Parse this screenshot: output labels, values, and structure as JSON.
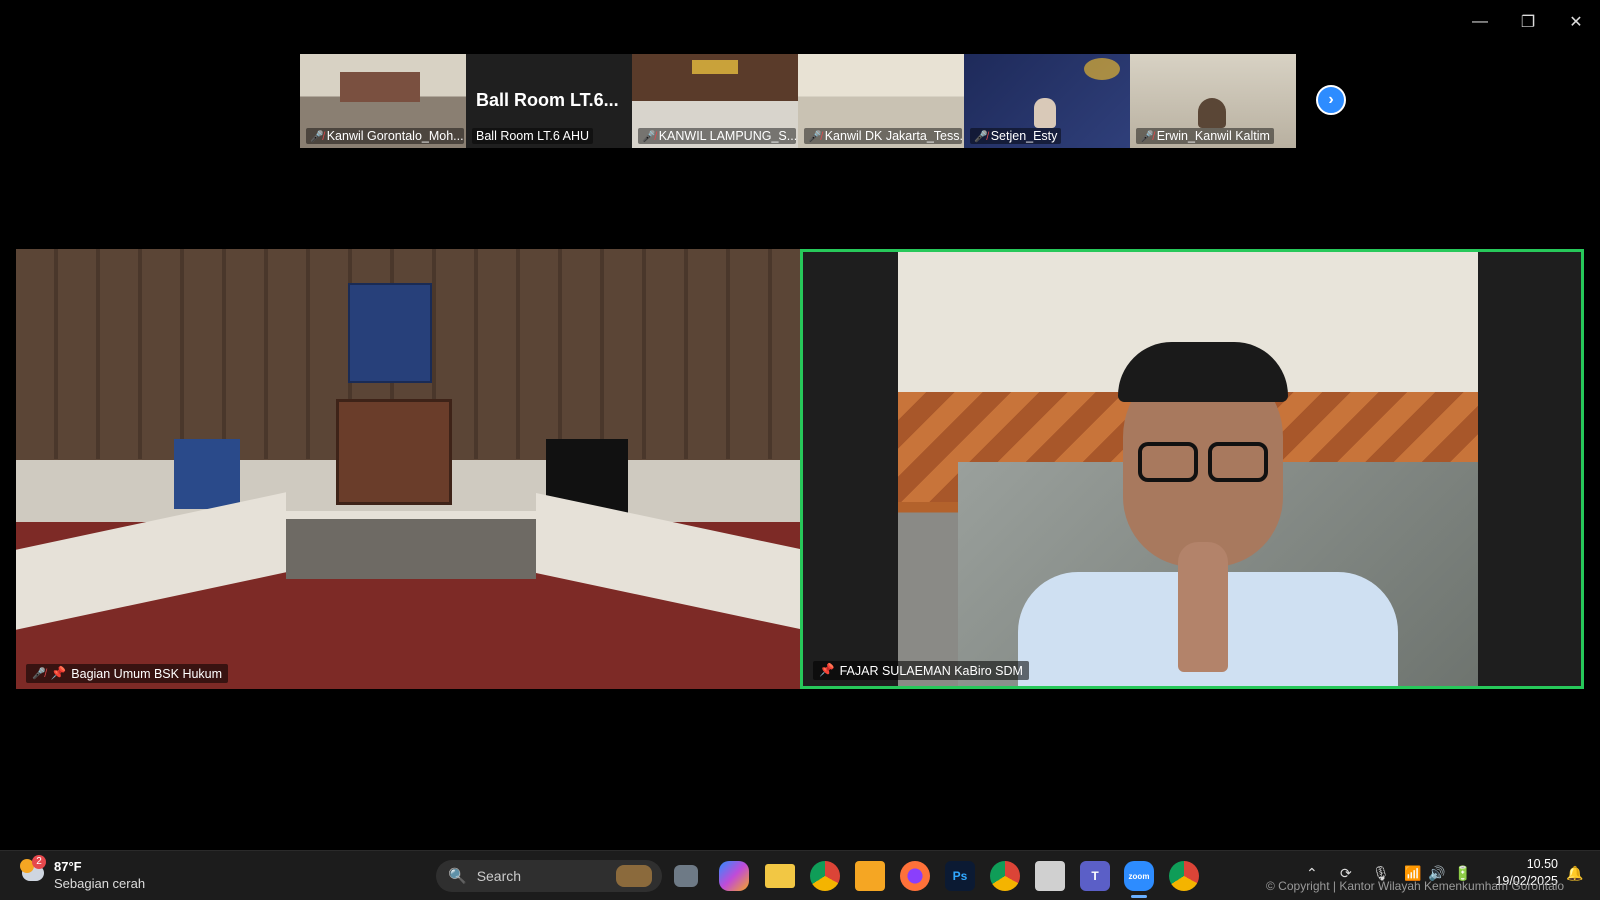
{
  "window_controls": {
    "minimize": "—",
    "restore": "❐",
    "close": "✕"
  },
  "thumbnails": [
    {
      "name": "Kanwil Gorontalo_Moh...",
      "muted": true,
      "bg": "#8a7f72"
    },
    {
      "name": "Ball Room LT.6 AHU",
      "title": "Ball Room LT.6...",
      "muted": false,
      "bg": "#1f1f1f"
    },
    {
      "name": "KANWIL LAMPUNG_S...",
      "muted": true,
      "bg": "#5a3b2a"
    },
    {
      "name": "Kanwil DK Jakarta_Tess...",
      "muted": true,
      "bg": "#c9c2b3"
    },
    {
      "name": "Setjen_Esty",
      "muted": true,
      "bg": "#1e2a5a"
    },
    {
      "name": "Erwin_Kanwil Kaltim",
      "muted": true,
      "bg": "#b8b0a0"
    }
  ],
  "next_icon": "chevron-right-icon",
  "main_tiles": [
    {
      "name": "Bagian Umum BSK Hukum",
      "muted": true,
      "pinned": true
    },
    {
      "name": "FAJAR SULAEMAN KaBiro SDM",
      "muted": false,
      "pinned": true,
      "active_speaker": true
    }
  ],
  "taskbar": {
    "weather_temp": "87°F",
    "weather_desc": "Sebagian cerah",
    "weather_badge": "2",
    "search_placeholder": "Search",
    "apps": [
      "start",
      "task-view",
      "copilot",
      "file-explorer",
      "chrome",
      "media-player",
      "firefox",
      "photoshop",
      "chrome-profile",
      "store",
      "teams",
      "zoom",
      "chrome-profile-2"
    ],
    "ps_label": "Ps",
    "zoom_label": "zoom",
    "time": "10.50",
    "date": "19/02/2025"
  },
  "watermark": "© Copyright | Kantor Wilayah Kemenkumham Gorontalo",
  "colors": {
    "accent_green": "#27c85a",
    "zoom_blue": "#2d8cff",
    "muted_red": "#e5484d"
  }
}
